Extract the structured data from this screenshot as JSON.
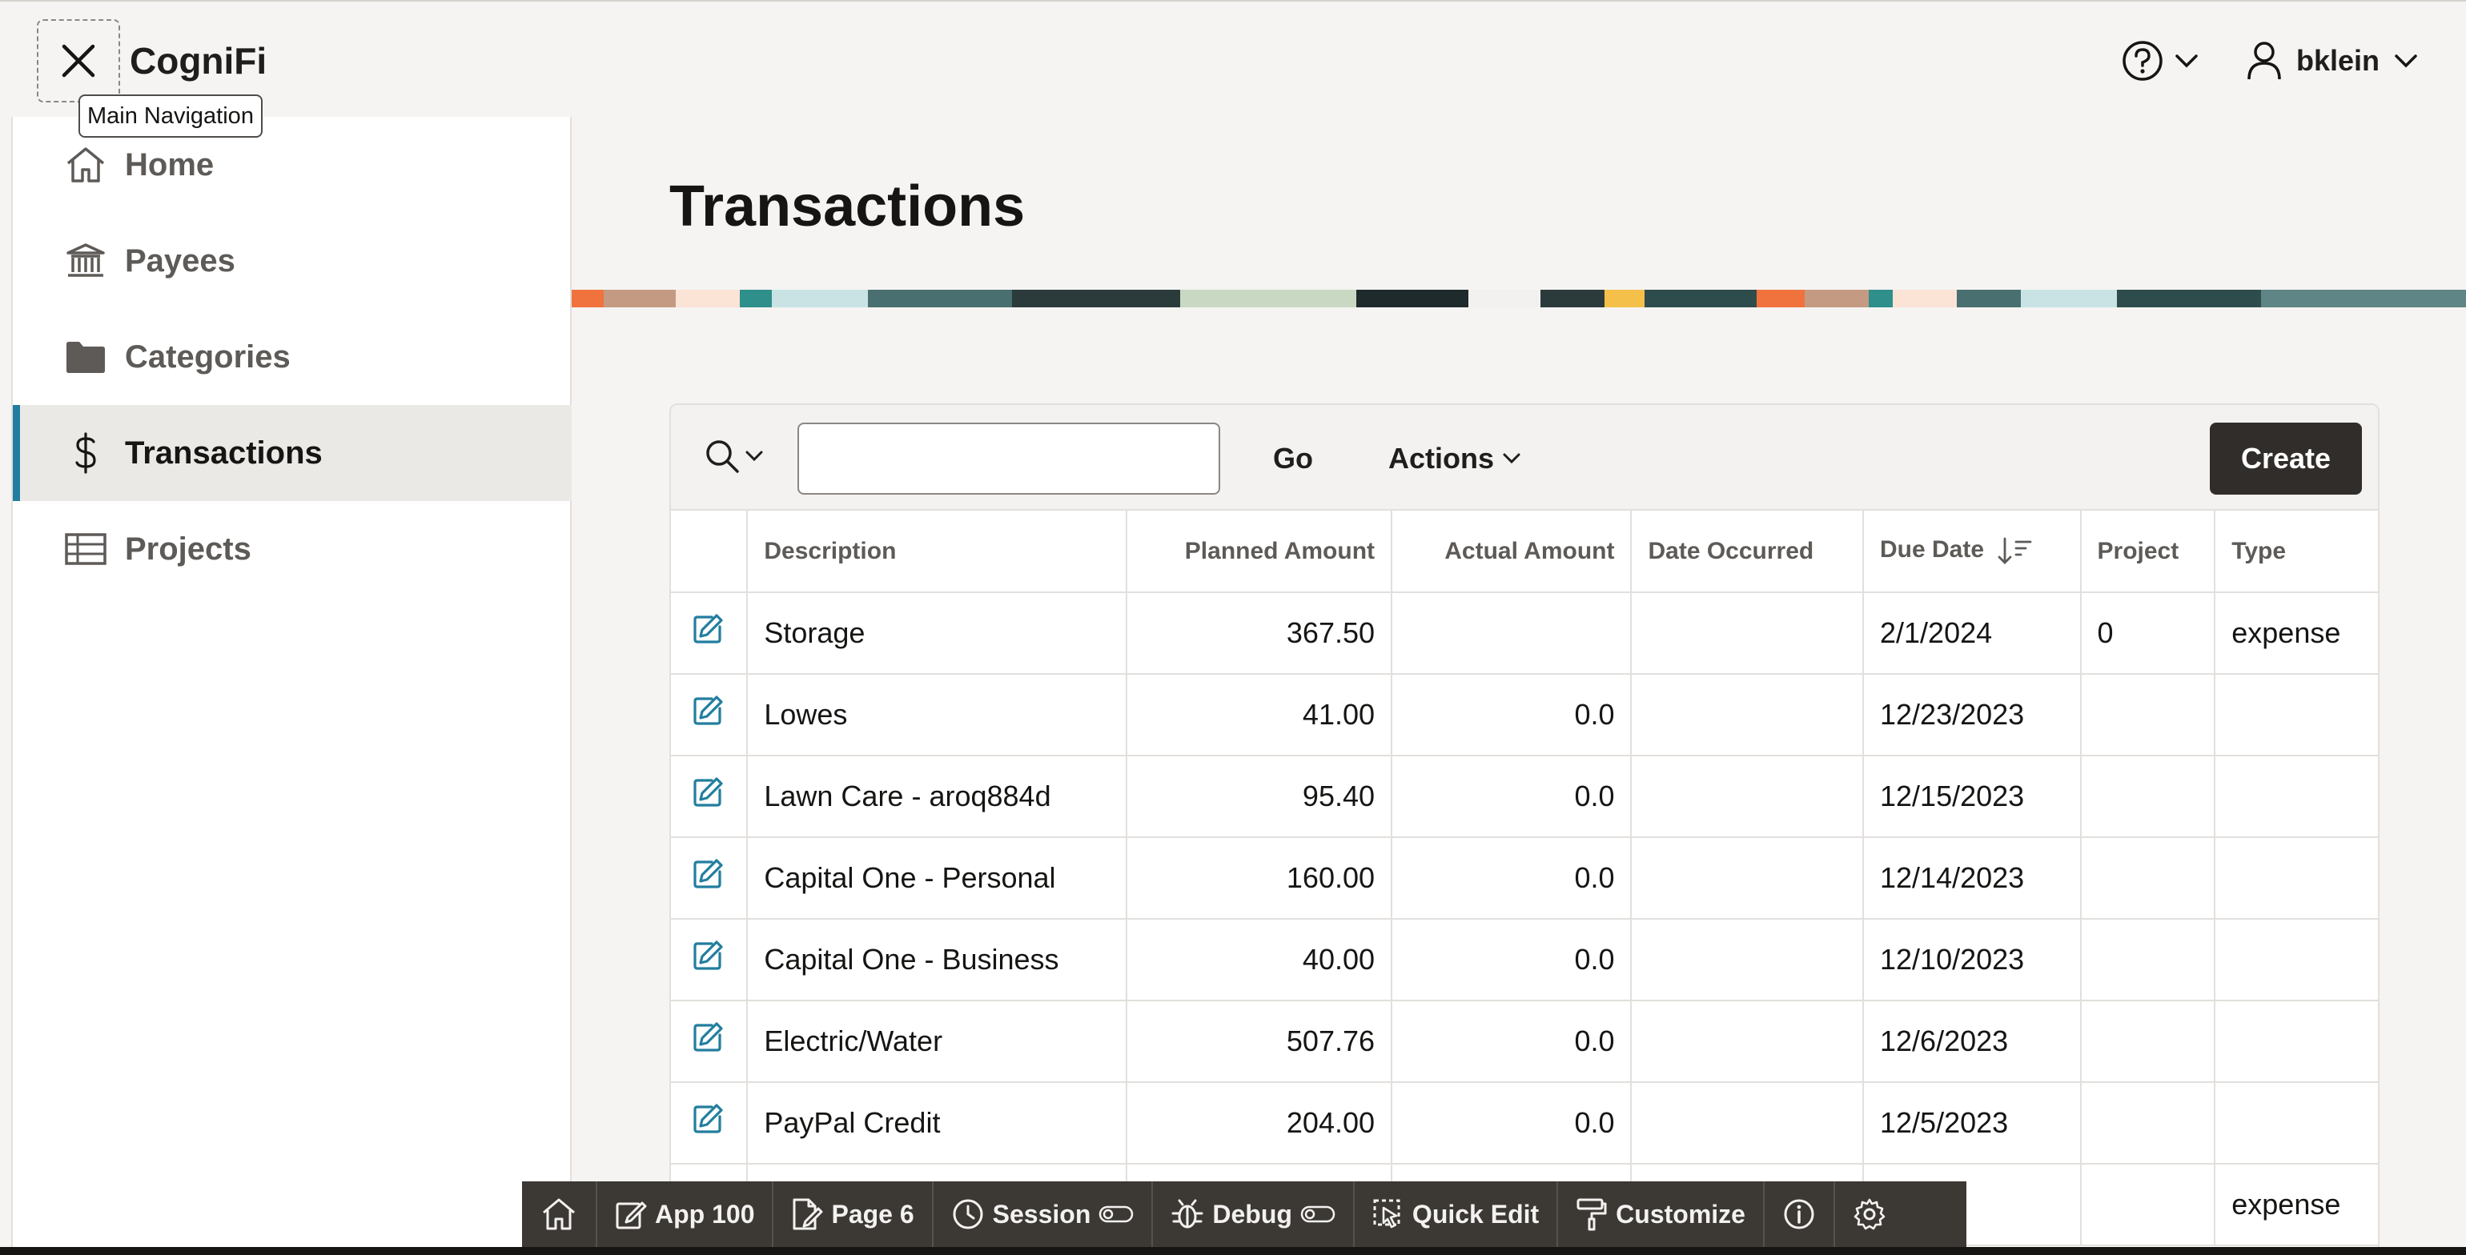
{
  "header": {
    "app_name": "CogniFi",
    "tooltip": "Main Navigation",
    "user_name": "bklein"
  },
  "sidebar": {
    "items": [
      {
        "label": "Home",
        "icon": "home-icon",
        "active": false
      },
      {
        "label": "Payees",
        "icon": "bank-icon",
        "active": false
      },
      {
        "label": "Categories",
        "icon": "folder-icon",
        "active": false
      },
      {
        "label": "Transactions",
        "icon": "dollar-icon",
        "active": true
      },
      {
        "label": "Projects",
        "icon": "table-icon",
        "active": false
      }
    ]
  },
  "main": {
    "title": "Transactions",
    "toolbar": {
      "search_value": "",
      "go_label": "Go",
      "actions_label": "Actions",
      "create_label": "Create"
    },
    "table": {
      "columns": [
        "",
        "Description",
        "Planned Amount",
        "Actual Amount",
        "Date Occurred",
        "Due Date",
        "Project",
        "Type"
      ],
      "rows": [
        [
          "Storage",
          "367.50",
          "",
          "",
          "2/1/2024",
          "0",
          "expense"
        ],
        [
          "Lowes",
          "41.00",
          "0.0",
          "",
          "12/23/2023",
          "",
          ""
        ],
        [
          "Lawn Care - aroq884d",
          "95.40",
          "0.0",
          "",
          "12/15/2023",
          "",
          ""
        ],
        [
          "Capital One - Personal",
          "160.00",
          "0.0",
          "",
          "12/14/2023",
          "",
          ""
        ],
        [
          "Capital One - Business",
          "40.00",
          "0.0",
          "",
          "12/10/2023",
          "",
          ""
        ],
        [
          "Electric/Water",
          "507.76",
          "0.0",
          "",
          "12/6/2023",
          "",
          ""
        ],
        [
          "PayPal Credit",
          "204.00",
          "0.0",
          "",
          "12/5/2023",
          "",
          ""
        ],
        [
          "",
          "",
          "",
          "",
          "023",
          "",
          "expense"
        ]
      ]
    }
  },
  "dev_toolbar": {
    "items": [
      {
        "label": "",
        "icon": "home-icon"
      },
      {
        "label": "App 100",
        "icon": "edit-icon"
      },
      {
        "label": "Page 6",
        "icon": "page-edit-icon"
      },
      {
        "label": "Session",
        "icon": "clock-icon",
        "toggle": true
      },
      {
        "label": "Debug",
        "icon": "bug-icon",
        "toggle": true
      },
      {
        "label": "Quick Edit",
        "icon": "cursor-icon"
      },
      {
        "label": "Customize",
        "icon": "paint-roller-icon"
      },
      {
        "label": "",
        "icon": "info-icon"
      },
      {
        "label": "",
        "icon": "gear-icon"
      }
    ]
  },
  "colors": {
    "accent": "#227e9e",
    "primary_button": "#312d2a",
    "dev_toolbar": "#3c3935"
  }
}
